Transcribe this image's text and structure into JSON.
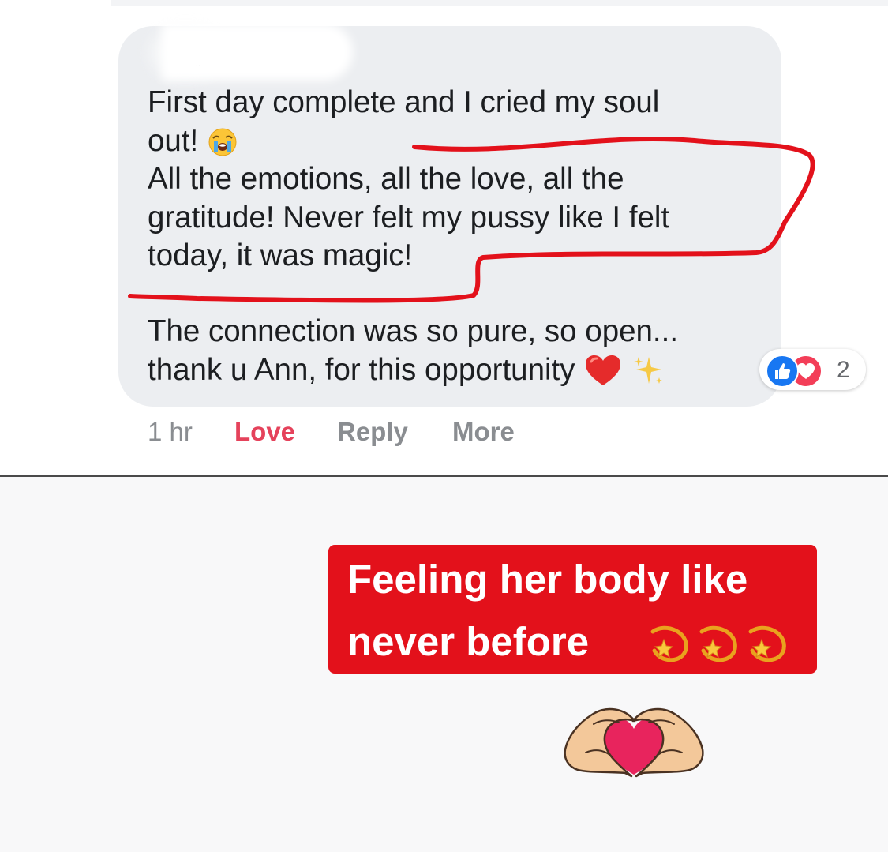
{
  "comment": {
    "paragraph_1": {
      "line_1": "First day complete and I cried my soul",
      "line_2": "out!",
      "line_2_emoji": "loudly-crying-face-emoji",
      "line_3": "All the emotions, all the love, all the",
      "line_4": "gratitude! Never felt my pussy like I felt",
      "line_5": "today, it was magic!"
    },
    "paragraph_2": {
      "line_1": "The connection was so pure, so open...",
      "line_2": "thank u Ann, for this opportunity",
      "line_2_emojis": [
        "red-heart-emoji",
        "sparkles-emoji"
      ]
    },
    "reactions": {
      "types": [
        "like-icon",
        "love-icon"
      ],
      "count": "2"
    },
    "actions": {
      "time": "1 hr",
      "love_label": "Love",
      "reply_label": "Reply",
      "more_label": "More"
    }
  },
  "caption": {
    "line_1": "Feeling her body like",
    "line_2": "never before",
    "emojis": [
      "dizzy-emoji",
      "dizzy-emoji",
      "dizzy-emoji"
    ]
  },
  "sticker": "heart-hands-emoji",
  "colors": {
    "bubble": "#eceef1",
    "caption_bg": "#e3111b",
    "annotation": "#e3111b",
    "love_action": "#e5425b",
    "like": "#1877f2",
    "love": "#f33e58"
  }
}
